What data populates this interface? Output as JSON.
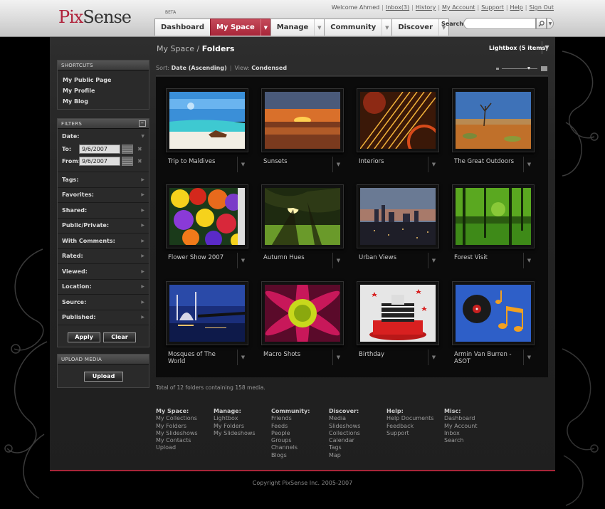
{
  "header": {
    "logo_pix": "Pix",
    "logo_sense": "Sense",
    "logo_beta": "BETA",
    "welcome": "Welcome Ahmed",
    "links": [
      "Inbox(3)",
      "History",
      "My Account",
      "Support",
      "Help",
      "Sign Out"
    ],
    "search_label": "Search",
    "search_placeholder": ""
  },
  "nav": {
    "tabs": [
      {
        "label": "Dashboard",
        "has_arrow": false,
        "active": false
      },
      {
        "label": "My Space",
        "has_arrow": true,
        "active": true
      },
      {
        "label": "Manage",
        "has_arrow": true,
        "active": false
      },
      {
        "label": "Community",
        "has_arrow": true,
        "active": false
      },
      {
        "label": "Discover",
        "has_arrow": true,
        "active": false
      }
    ]
  },
  "sidebar": {
    "shortcuts_title": "SHORTCUTS",
    "shortcuts": [
      "My Public Page",
      "My Profile",
      "My Blog"
    ],
    "filters_title": "FILTERS",
    "date_label": "Date:",
    "to_label": "To:",
    "to_value": "9/6/2007",
    "from_label": "From:",
    "from_value": "9/6/2007",
    "filters": [
      "Tags:",
      "Favorites:",
      "Shared:",
      "Public/Private:",
      "With Comments:",
      "Rated:",
      "Viewed:",
      "Location:",
      "Source:",
      "Published:"
    ],
    "apply_label": "Apply",
    "clear_label": "Clear",
    "upload_title": "UPLOAD MEDIA",
    "upload_label": "Upload"
  },
  "main": {
    "breadcrumb_parent": "My Space",
    "breadcrumb_sep": " / ",
    "breadcrumb_current": "Folders",
    "lightbox": "Lightbox (5 items)",
    "sort_label": "Sort:",
    "sort_value": "Date (Ascending)",
    "view_label": "View:",
    "view_value": "Condensed",
    "folders": [
      {
        "title": "Trip to Maldives"
      },
      {
        "title": "Sunsets"
      },
      {
        "title": "Interiors"
      },
      {
        "title": "The Great Outdoors"
      },
      {
        "title": "Flower Show 2007"
      },
      {
        "title": "Autumn Hues"
      },
      {
        "title": "Urban Views"
      },
      {
        "title": "Forest Visit"
      },
      {
        "title": "Mosques of The World"
      },
      {
        "title": "Macro Shots"
      },
      {
        "title": "Birthday"
      },
      {
        "title": "Armin Van Burren - ASOT"
      }
    ],
    "total": "Total of 12 folders containing 158 media."
  },
  "footer": {
    "columns": [
      {
        "title": "My Space:",
        "links": [
          "My Collections",
          "My Folders",
          "My Slideshows",
          "My Contacts",
          "Upload"
        ]
      },
      {
        "title": "Manage:",
        "links": [
          "Lightbox",
          "My Folders",
          "My Slideshows"
        ]
      },
      {
        "title": "Community:",
        "links": [
          "Friends",
          "Feeds",
          "People",
          "Groups",
          "Channels",
          "Blogs"
        ]
      },
      {
        "title": "Discover:",
        "links": [
          "Media",
          "Slideshows",
          "Collections",
          "Calendar",
          "Tags",
          "Map"
        ]
      },
      {
        "title": "Help:",
        "links": [
          "Help Documents",
          "Feedback",
          "Support"
        ]
      },
      {
        "title": "Misc:",
        "links": [
          "Dashboard",
          "My Account",
          "Inbox",
          "Search"
        ]
      }
    ],
    "copyright": "Copyright PixSense Inc. 2005-2007"
  },
  "colors": {
    "accent": "#a82639",
    "background": "#000000",
    "panel": "#2a2a2a"
  }
}
